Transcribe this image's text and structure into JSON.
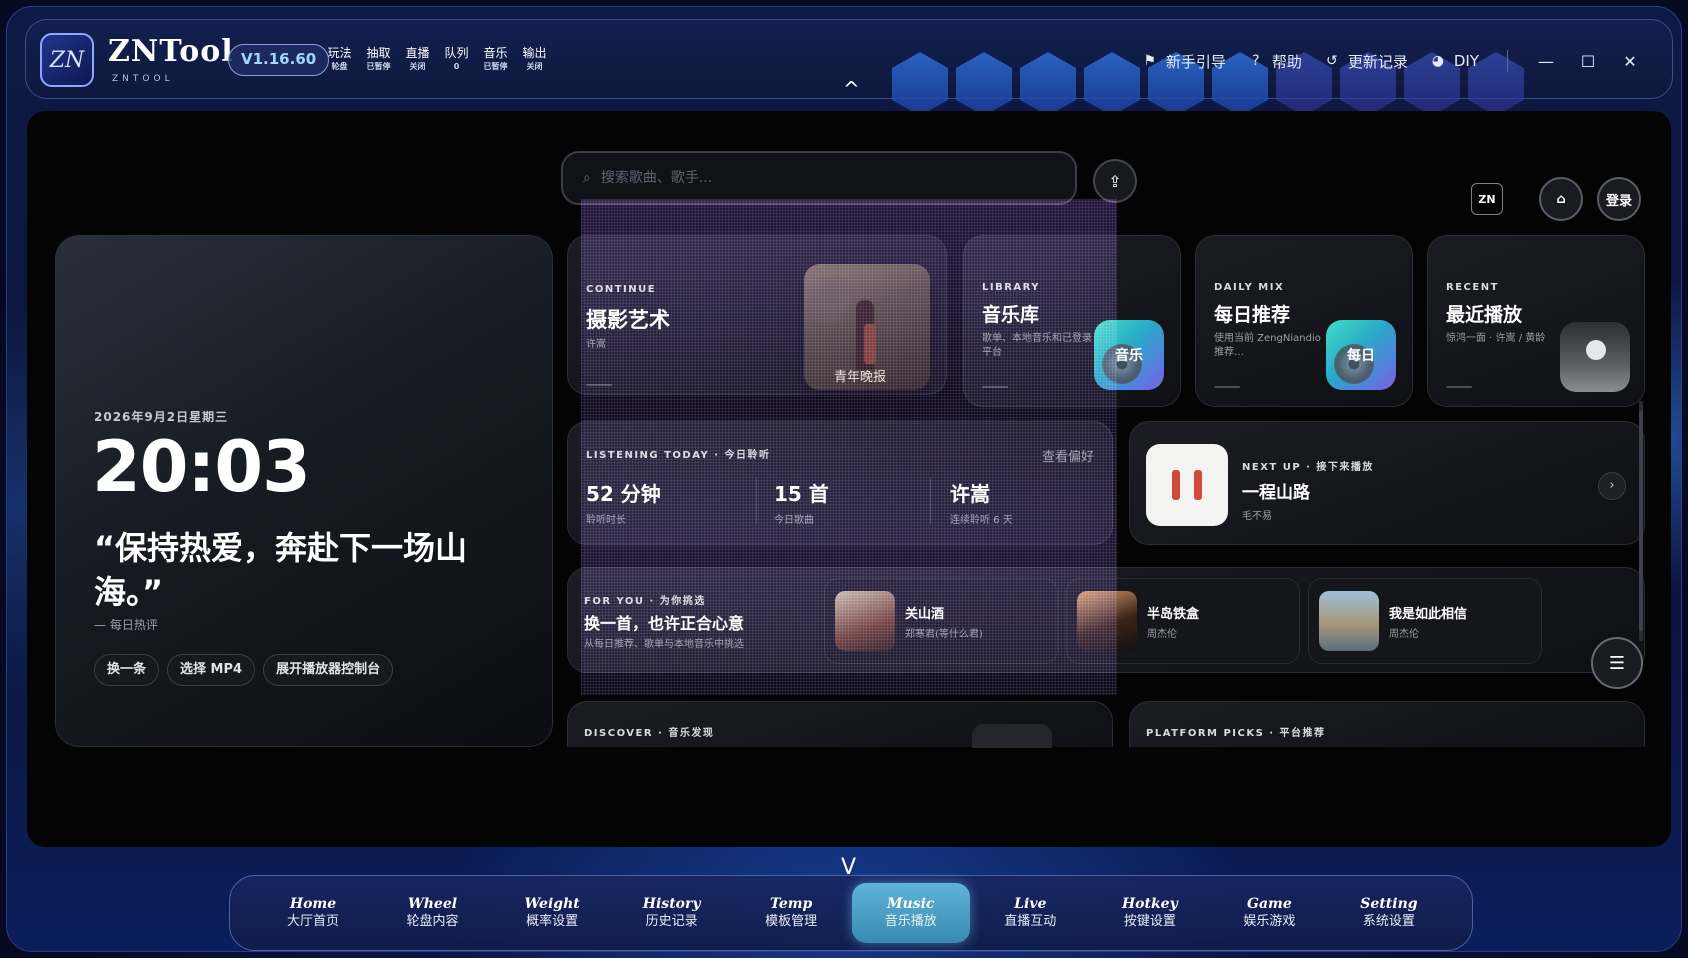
{
  "app": {
    "logo_text": "ZN",
    "title": "ZNTool",
    "subtitle": "ZNTOOL",
    "version": "V1.16.60"
  },
  "status": [
    {
      "label": "玩法",
      "value": "轮盘"
    },
    {
      "label": "抽取",
      "value": "已暂停"
    },
    {
      "label": "直播",
      "value": "关闭"
    },
    {
      "label": "队列",
      "value": "0"
    },
    {
      "label": "音乐",
      "value": "已暂停"
    },
    {
      "label": "输出",
      "value": "关闭"
    }
  ],
  "top_actions": {
    "guide": "新手引导",
    "help": "帮助",
    "changelog": "更新记录",
    "diy": "DIY"
  },
  "window": {
    "minimize": "—",
    "maximize": "☐",
    "close": "✕"
  },
  "chevron_up": "^",
  "chevron_down": "V",
  "search": {
    "placeholder": "搜索歌曲、歌手..."
  },
  "header_right": {
    "badge": "ZN",
    "login": "登录"
  },
  "clock": {
    "date": "2026年9月2日星期三",
    "time": "20:03",
    "quote": "“保持热爱，奔赴下一场山海。”",
    "source": "— 每日热评",
    "buttons": [
      "换一条",
      "选择 MP4",
      "展开播放器控制台"
    ]
  },
  "continue_card": {
    "kicker": "CONTINUE",
    "title": "摄影艺术",
    "artist": "许嵩",
    "cover_caption": "青年晚报"
  },
  "library_card": {
    "kicker": "LIBRARY",
    "title": "音乐库",
    "desc": "歌单、本地音乐和已登录平台",
    "cover_label": "音乐"
  },
  "daily_card": {
    "kicker": "DAILY MIX",
    "title": "每日推荐",
    "desc": "使用当前 ZengNiandio 推荐…",
    "cover_label": "每日"
  },
  "recent_card": {
    "kicker": "RECENT",
    "title": "最近播放",
    "desc": "惊鸿一面 · 许嵩 / 黄龄"
  },
  "listening": {
    "kicker": "LISTENING TODAY · 今日聆听",
    "pref_link": "查看偏好",
    "stats": [
      {
        "value": "52 分钟",
        "label": "聆听时长"
      },
      {
        "value": "15 首",
        "label": "今日歌曲"
      },
      {
        "value": "许嵩",
        "label": "连续聆听 6 天"
      }
    ]
  },
  "next_up": {
    "kicker": "NEXT UP · 接下来播放",
    "title": "一程山路",
    "artist": "毛不易",
    "arrow": "›"
  },
  "for_you": {
    "kicker": "FOR YOU · 为你挑选",
    "title": "换一首，也许正合心意",
    "desc": "从每日推荐、歌单与本地音乐中挑选",
    "songs": [
      {
        "title": "关山酒",
        "artist": "郑寒君(等什么君)"
      },
      {
        "title": "半岛铁盒",
        "artist": "周杰伦"
      },
      {
        "title": "我是如此相信",
        "artist": "周杰伦"
      }
    ]
  },
  "discover": {
    "kicker": "DISCOVER · 音乐发现"
  },
  "platform": {
    "kicker": "PLATFORM PICKS · 平台推荐"
  },
  "bottom_nav": [
    {
      "en": "Home",
      "zh": "大厅首页",
      "active": false
    },
    {
      "en": "Wheel",
      "zh": "轮盘内容",
      "active": false
    },
    {
      "en": "Weight",
      "zh": "概率设置",
      "active": false
    },
    {
      "en": "History",
      "zh": "历史记录",
      "active": false
    },
    {
      "en": "Temp",
      "zh": "模板管理",
      "active": false
    },
    {
      "en": "Music",
      "zh": "音乐播放",
      "active": true
    },
    {
      "en": "Live",
      "zh": "直播互动",
      "active": false
    },
    {
      "en": "Hotkey",
      "zh": "按键设置",
      "active": false
    },
    {
      "en": "Game",
      "zh": "娱乐游戏",
      "active": false
    },
    {
      "en": "Setting",
      "zh": "系统设置",
      "active": false
    }
  ],
  "colors": {
    "accent": "#5fb4d6",
    "version_text": "#9fd8ff",
    "panel_bg": "#040405"
  }
}
